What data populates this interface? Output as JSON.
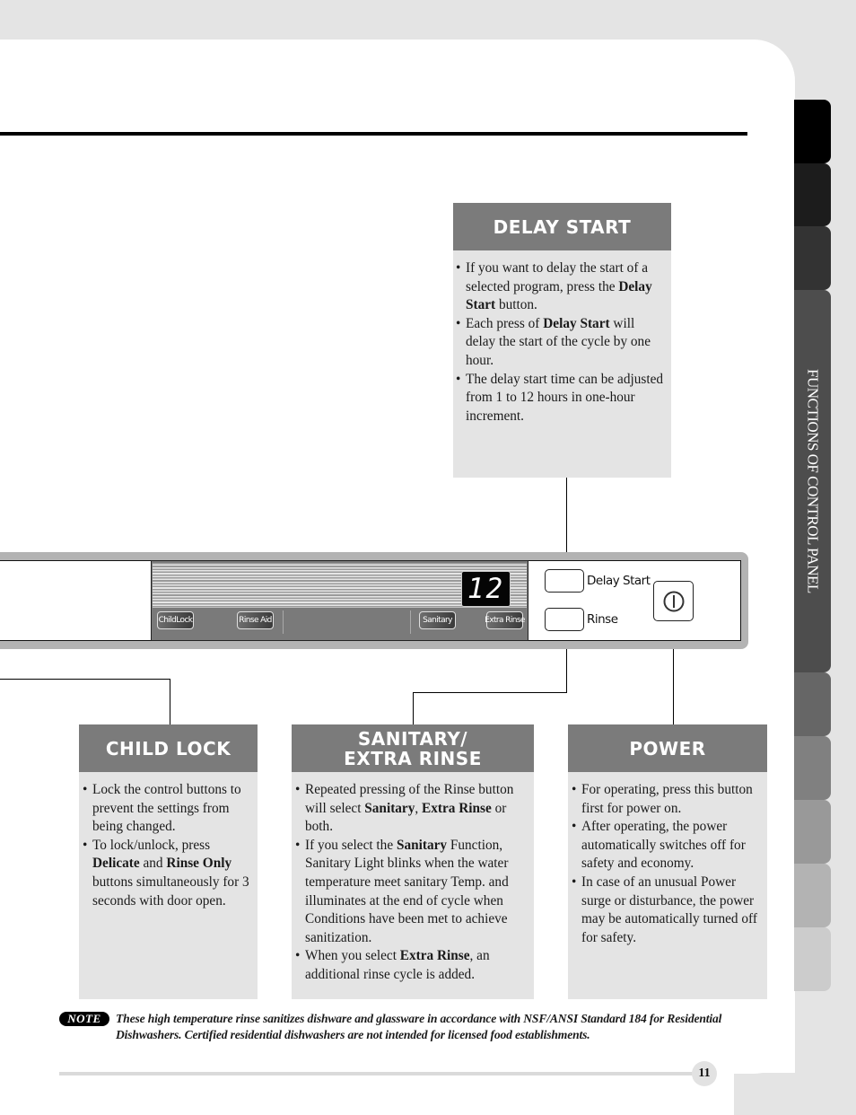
{
  "side_tabs": [
    {
      "label": "",
      "color": "#000000"
    },
    {
      "label": "",
      "color": "#1c1c1c"
    },
    {
      "label": "",
      "color": "#333333"
    },
    {
      "label": "FUNCTIONS OF CONTROL PANEL",
      "color": "#4d4d4d",
      "active": true
    },
    {
      "label": "",
      "color": "#666666"
    },
    {
      "label": "",
      "color": "#808080"
    },
    {
      "label": "",
      "color": "#999999"
    },
    {
      "label": "",
      "color": "#b3b3b3"
    },
    {
      "label": "",
      "color": "#cccccc"
    }
  ],
  "control_panel": {
    "display_value": "12",
    "strip_buttons": [
      "ChildLock",
      "Rinse Aid",
      "Sanitary",
      "Extra Rinse"
    ],
    "delay_start_label": "Delay Start",
    "rinse_label": "Rinse",
    "power_icon": "power-icon"
  },
  "boxes": {
    "delay_start": {
      "title": "DELAY START",
      "items": [
        "If you want to delay the start of a selected program, press the <b>Delay Start</b> button.",
        "Each press of <b>Delay Start</b> will delay the start of the cycle by one hour.",
        "The delay start time can be adjusted from 1 to 12 hours in one-hour increment."
      ]
    },
    "child_lock": {
      "title": "CHILD LOCK",
      "items": [
        "Lock the control buttons to prevent the settings from being changed.",
        "To lock/unlock, press <b>Delicate</b> and <b>Rinse Only</b> buttons simultaneously for 3 seconds with door open."
      ]
    },
    "sanitary": {
      "title_line1": "SANITARY/",
      "title_line2": "EXTRA RINSE",
      "items": [
        "Repeated pressing of the Rinse button will select <b>Sanitary</b>, <b>Extra Rinse</b> or both.",
        "If you select the <b>Sanitary</b> Function, Sanitary Light blinks when the water temperature meet sanitary Temp. and illuminates at the end of cycle when Conditions have been met to achieve sanitization.",
        "When you select <b>Extra Rinse</b>, an additional rinse cycle is added."
      ]
    },
    "power": {
      "title": "POWER",
      "items": [
        "For operating, press this button first for power on.",
        "After operating, the power automatically switches off for safety and economy.",
        "In case of an unusual Power surge or disturbance, the power may be automatically turned off for safety."
      ]
    }
  },
  "note": {
    "badge": "NOTE",
    "text": "These high temperature rinse sanitizes dishware and glassware in accordance with NSF/ANSI Standard 184 for Residential Dishwashers. Certified residential dishwashers are not intended for licensed food establishments."
  },
  "page_number": "11"
}
